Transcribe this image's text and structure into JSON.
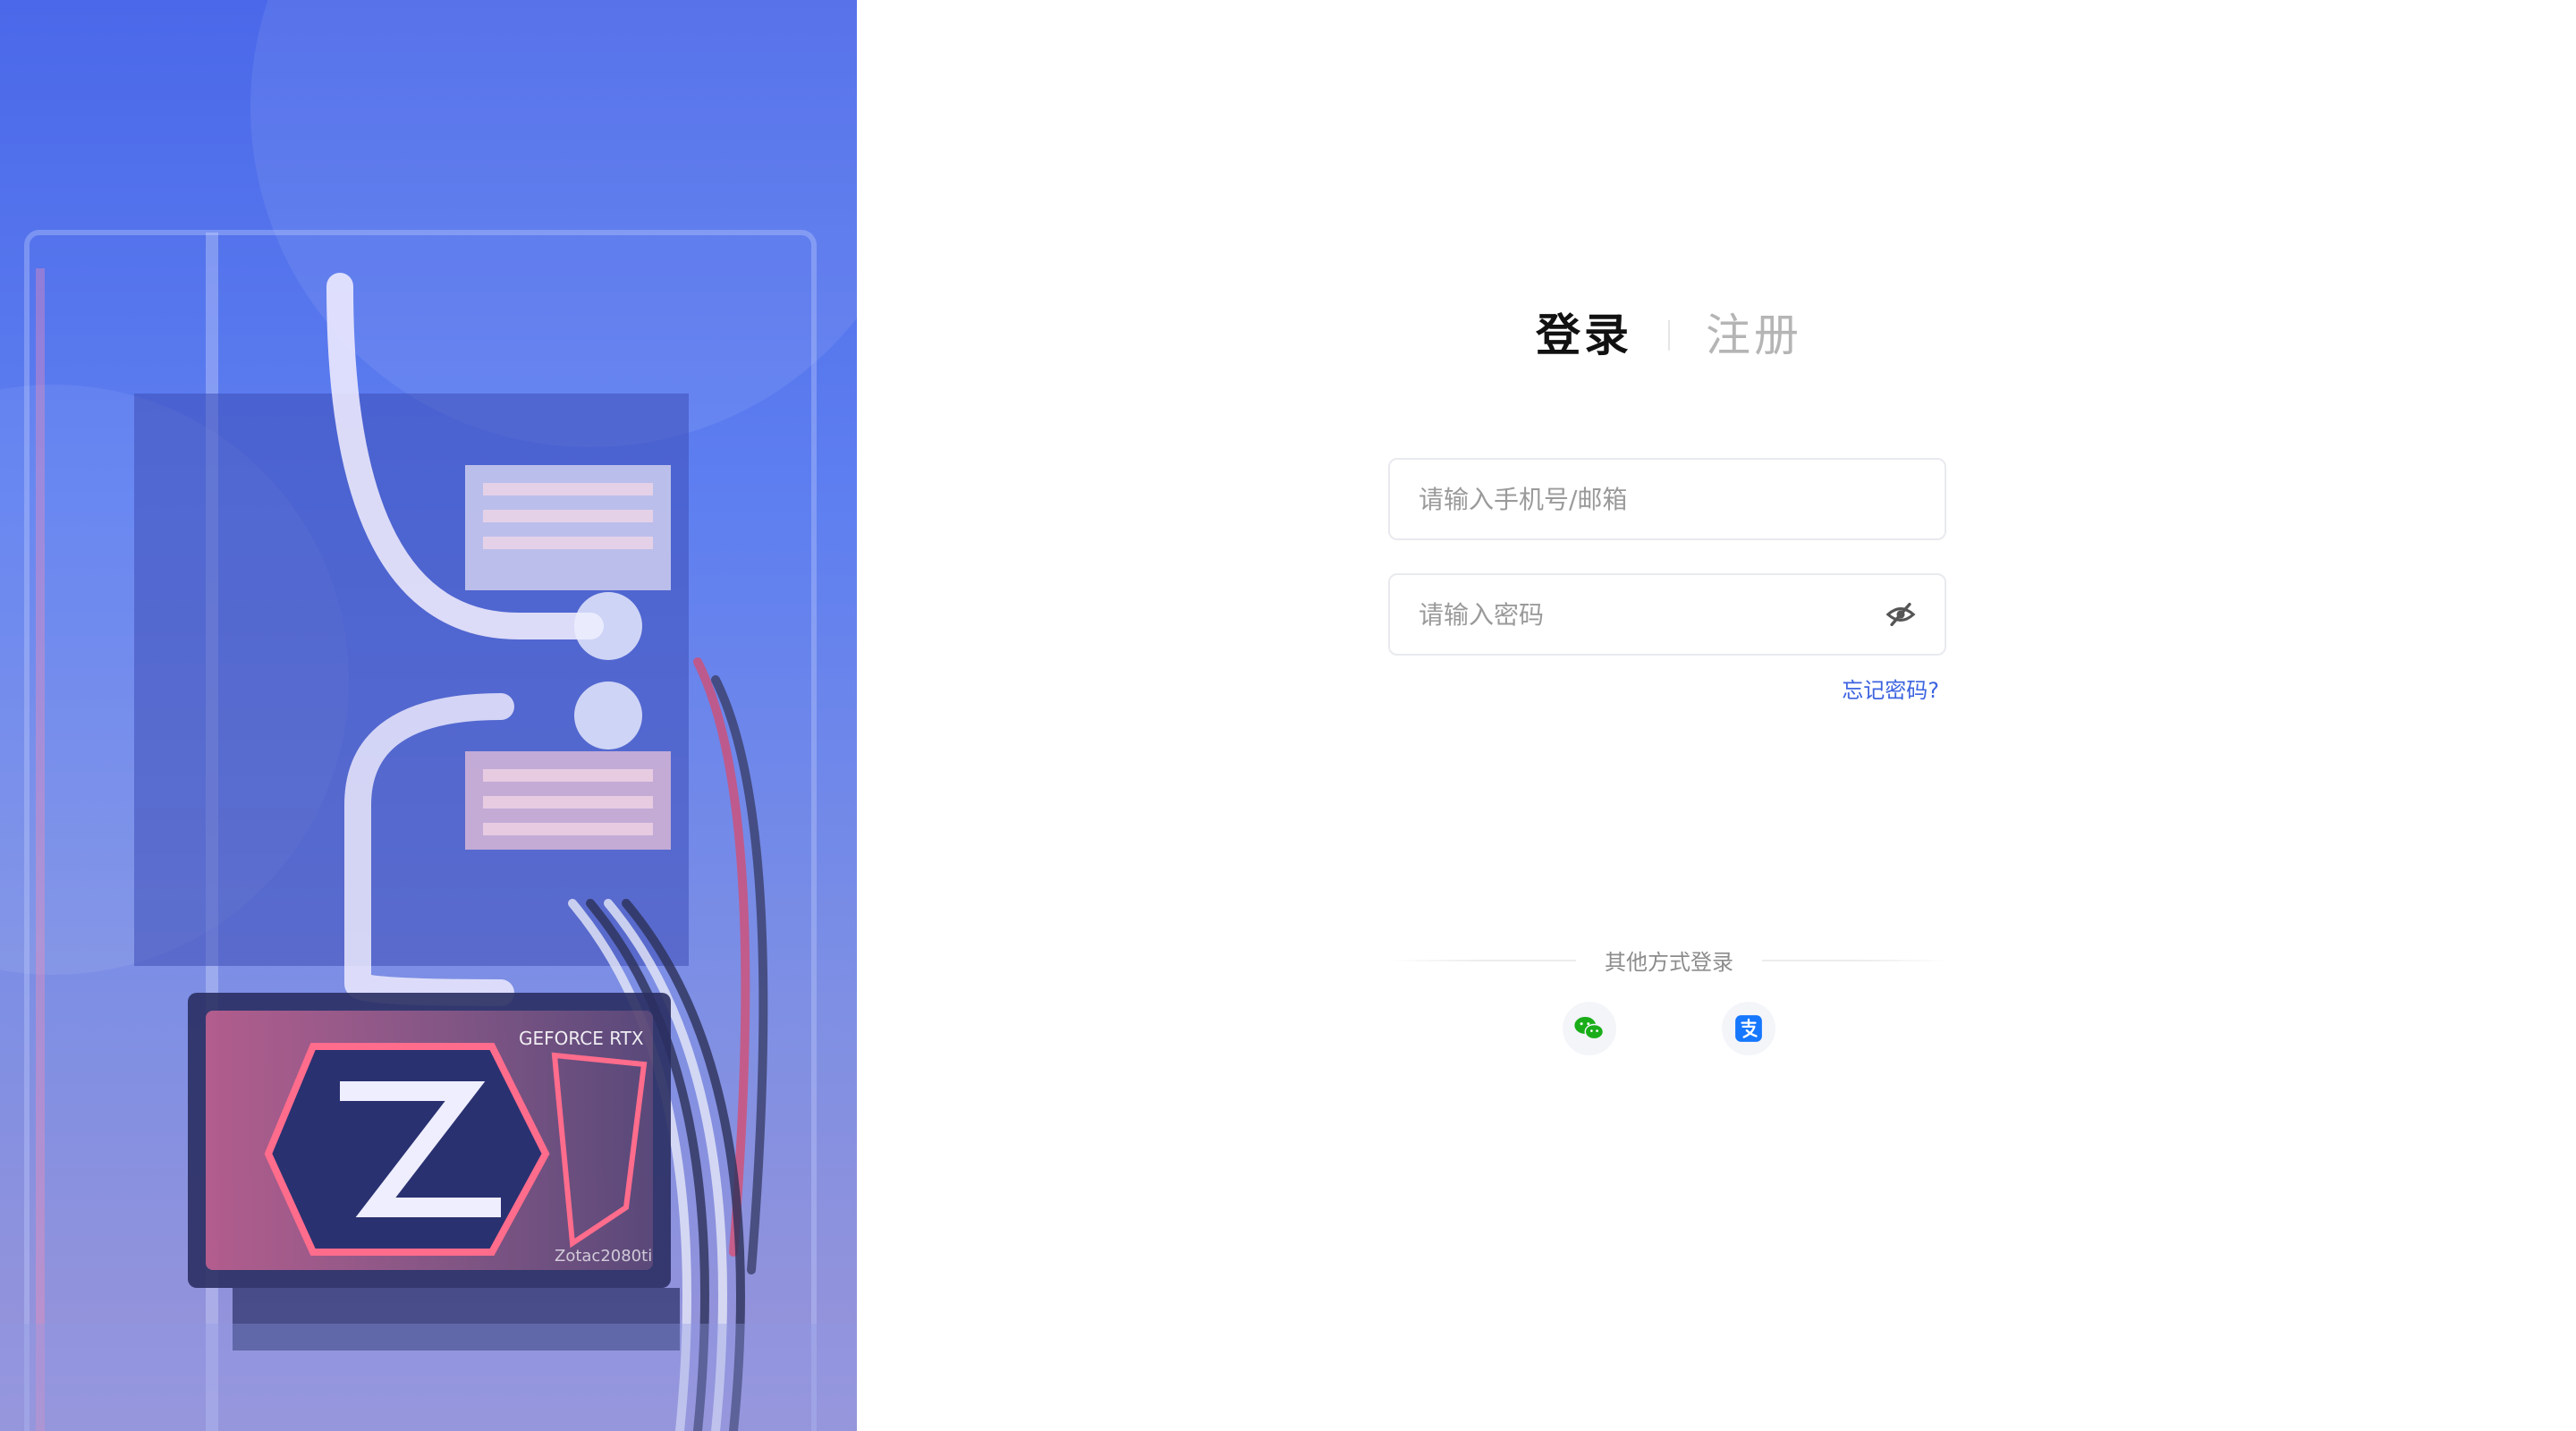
{
  "tabs": {
    "login_label": "登录",
    "register_label": "注册"
  },
  "form": {
    "account_placeholder": "请输入手机号/邮箱",
    "password_placeholder": "请输入密码",
    "forgot_label": "忘记密码?"
  },
  "other_login": {
    "label": "其他方式登录",
    "providers": [
      {
        "name": "wechat",
        "icon": "wechat-icon",
        "color": "#1aad19"
      },
      {
        "name": "alipay",
        "icon": "alipay-icon",
        "color": "#1677ff"
      }
    ]
  },
  "colors": {
    "accent": "#3d63e0",
    "hero_gradient_top": "#4b6ae8",
    "hero_gradient_bottom": "#8a8fdc"
  },
  "hero": {
    "gpu_brand_text": "GEFORCE RTX",
    "gpu_model_text": "Zotac2080ti"
  }
}
